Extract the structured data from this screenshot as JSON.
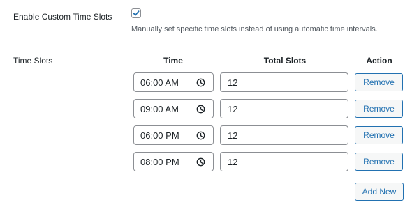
{
  "settings": {
    "enable_label": "Enable Custom Time Slots",
    "enable_checked": true,
    "enable_description": "Manually set specific time slots instead of using automatic time intervals.",
    "time_slots_label": "Time Slots"
  },
  "table": {
    "headers": {
      "time": "Time",
      "total_slots": "Total Slots",
      "action": "Action"
    },
    "rows": [
      {
        "time": "06:00 AM",
        "total_slots": "12",
        "action": "Remove"
      },
      {
        "time": "09:00 AM",
        "total_slots": "12",
        "action": "Remove"
      },
      {
        "time": "06:00 PM",
        "total_slots": "12",
        "action": "Remove"
      },
      {
        "time": "08:00 PM",
        "total_slots": "12",
        "action": "Remove"
      }
    ],
    "add_new_label": "Add New"
  },
  "colors": {
    "accent": "#2271b1",
    "border": "#8c8f94",
    "text": "#1d2327",
    "muted_text": "#50575e"
  }
}
